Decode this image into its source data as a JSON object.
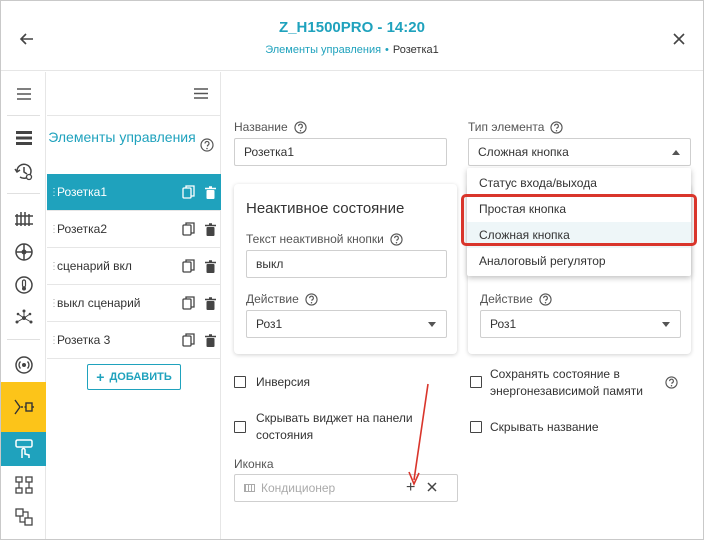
{
  "header": {
    "title": "Z_H1500PRO - 14:20",
    "breadcrumb_link": "Элементы управления",
    "breadcrumb_sep": "•",
    "breadcrumb_current": "Розетка1"
  },
  "list": {
    "title": "Элементы управления",
    "items": [
      {
        "label": "Розетка1",
        "selected": true
      },
      {
        "label": "Розетка2",
        "selected": false
      },
      {
        "label": "сценарий вкл",
        "selected": false
      },
      {
        "label": "выкл сценарий",
        "selected": false
      },
      {
        "label": "Розетка 3",
        "selected": false
      }
    ],
    "add_label": "ДОБАВИТЬ"
  },
  "form": {
    "name_label": "Название",
    "name_value": "Розетка1",
    "type_label": "Тип элемента",
    "type_value": "Сложная кнопка",
    "inactive": {
      "title": "Неактивное состояние",
      "text_label": "Текст неактивной кнопки",
      "text_value": "выкл",
      "action_label": "Действие",
      "action_value": "Роз1"
    },
    "active": {
      "action_label": "Действие",
      "action_value": "Роз1"
    },
    "inversion_label": "Инверсия",
    "save_state_label": "Сохранять состояние в энергонезависимой памяти",
    "hide_widget_label": "Скрывать виджет на панели состояния",
    "hide_name_label": "Скрывать название",
    "icon_label": "Иконка",
    "icon_placeholder": "Кондиционер"
  },
  "type_dropdown": {
    "options": [
      "Статус входа/выхода",
      "Простая кнопка",
      "Сложная кнопка",
      "Аналоговый регулятор"
    ],
    "highlighted_index": 2
  },
  "colors": {
    "accent": "#1fa2bd",
    "highlight": "#fcc419",
    "annotation": "#d9352b"
  }
}
